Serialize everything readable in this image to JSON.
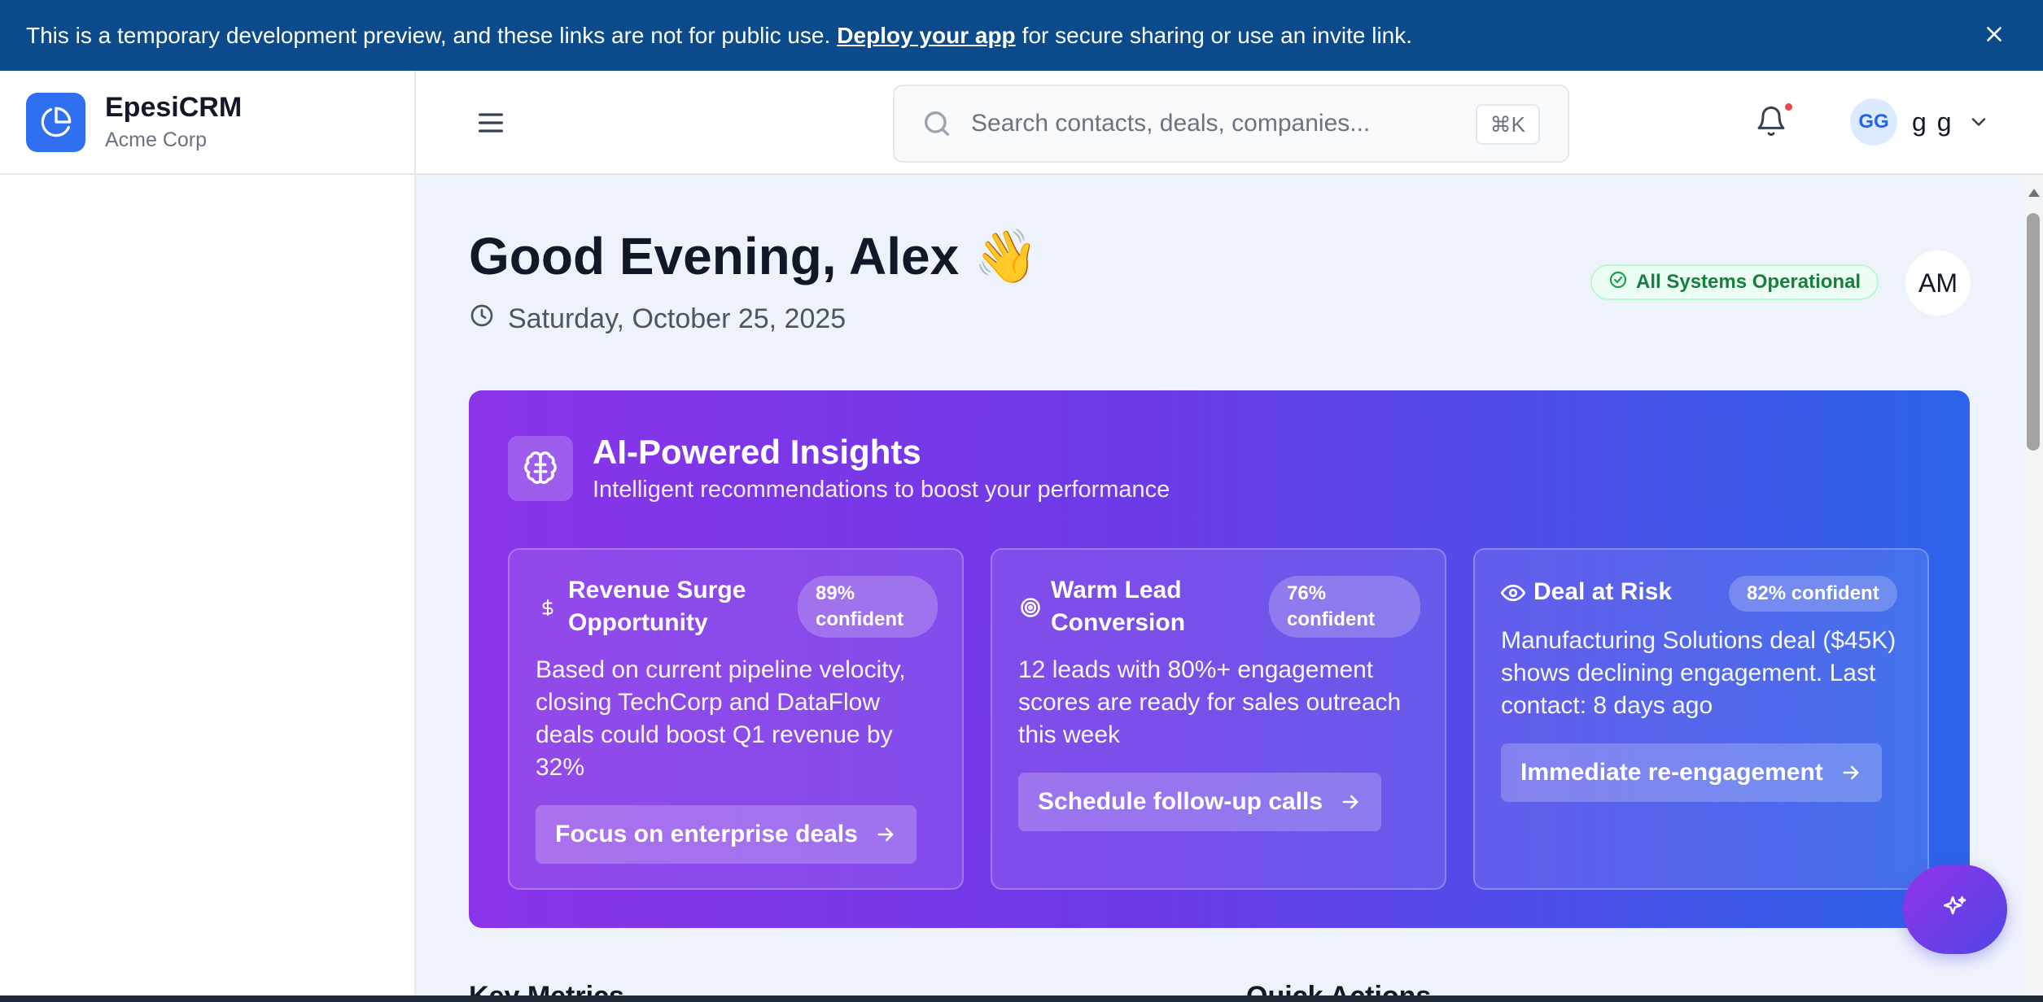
{
  "banner": {
    "text_before": "This is a temporary development preview, and these links are not for public use.",
    "link": "Deploy your app",
    "text_after": "for secure sharing or use an invite link.",
    "close_icon": "close-icon"
  },
  "brand": {
    "name": "EpesiCRM",
    "org": "Acme Corp",
    "logo_icon": "pie-chart-icon",
    "accent": "#2f6ff0"
  },
  "header": {
    "menu_icon": "hamburger-icon",
    "search": {
      "placeholder": "Search contacts, deals, companies...",
      "shortcut": "⌘K"
    },
    "notifications_icon": "bell-icon",
    "user": {
      "initials": "GG",
      "name": "g g"
    }
  },
  "main": {
    "greeting": "Good Evening, Alex 👋",
    "date": "Saturday, October 25, 2025",
    "status": "All Systems Operational",
    "avatar_initials": "AM",
    "ai": {
      "title": "AI-Powered Insights",
      "subtitle": "Intelligent recommendations to boost your performance",
      "cards": [
        {
          "icon": "dollar-icon",
          "title": "Revenue Surge Opportunity",
          "badge": "89% confident",
          "description": "Based on current pipeline velocity, closing TechCorp and DataFlow deals could boost Q1 revenue by 32%",
          "action": "Focus on enterprise deals"
        },
        {
          "icon": "target-icon",
          "title": "Warm Lead Conversion",
          "badge": "76% confident",
          "description": "12 leads with 80%+ engagement scores are ready for sales outreach this week",
          "action": "Schedule follow-up calls"
        },
        {
          "icon": "eye-icon",
          "title": "Deal at Risk",
          "badge": "82% confident",
          "description": "Manufacturing Solutions deal ($45K) shows declining engagement. Last contact: 8 days ago",
          "action": "Immediate re-engagement"
        }
      ]
    },
    "sections": {
      "left": "Key Metrics",
      "right": "Quick Actions"
    }
  },
  "fab_icon": "sparkles-icon",
  "colors": {
    "banner": "#0b4a8b",
    "gradient_start": "#8a34e8",
    "gradient_end": "#2c63ea",
    "status_green": "#15803d"
  }
}
